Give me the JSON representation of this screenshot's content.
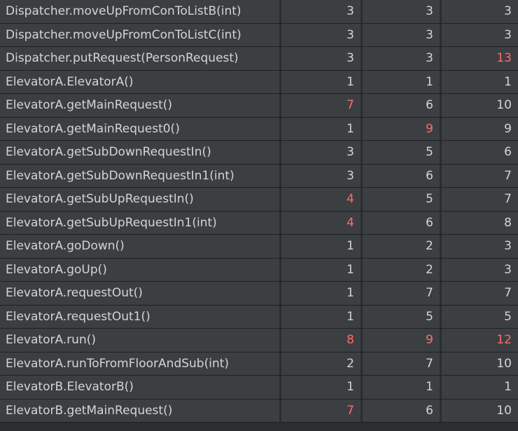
{
  "highlight_color": "#ff6b68",
  "rows": [
    {
      "method": "Dispatcher.moveUpFromConToListB(int)",
      "c1": "3",
      "c2": "3",
      "c3": "3",
      "h1": false,
      "h2": false,
      "h3": false
    },
    {
      "method": "Dispatcher.moveUpFromConToListC(int)",
      "c1": "3",
      "c2": "3",
      "c3": "3",
      "h1": false,
      "h2": false,
      "h3": false
    },
    {
      "method": "Dispatcher.putRequest(PersonRequest)",
      "c1": "3",
      "c2": "3",
      "c3": "13",
      "h1": false,
      "h2": false,
      "h3": true
    },
    {
      "method": "ElevatorA.ElevatorA()",
      "c1": "1",
      "c2": "1",
      "c3": "1",
      "h1": false,
      "h2": false,
      "h3": false
    },
    {
      "method": "ElevatorA.getMainRequest()",
      "c1": "7",
      "c2": "6",
      "c3": "10",
      "h1": true,
      "h2": false,
      "h3": false
    },
    {
      "method": "ElevatorA.getMainRequest0()",
      "c1": "1",
      "c2": "9",
      "c3": "9",
      "h1": false,
      "h2": true,
      "h3": false
    },
    {
      "method": "ElevatorA.getSubDownRequestIn()",
      "c1": "3",
      "c2": "5",
      "c3": "6",
      "h1": false,
      "h2": false,
      "h3": false
    },
    {
      "method": "ElevatorA.getSubDownRequestIn1(int)",
      "c1": "3",
      "c2": "6",
      "c3": "7",
      "h1": false,
      "h2": false,
      "h3": false
    },
    {
      "method": "ElevatorA.getSubUpRequestIn()",
      "c1": "4",
      "c2": "5",
      "c3": "7",
      "h1": true,
      "h2": false,
      "h3": false
    },
    {
      "method": "ElevatorA.getSubUpRequestIn1(int)",
      "c1": "4",
      "c2": "6",
      "c3": "8",
      "h1": true,
      "h2": false,
      "h3": false
    },
    {
      "method": "ElevatorA.goDown()",
      "c1": "1",
      "c2": "2",
      "c3": "3",
      "h1": false,
      "h2": false,
      "h3": false
    },
    {
      "method": "ElevatorA.goUp()",
      "c1": "1",
      "c2": "2",
      "c3": "3",
      "h1": false,
      "h2": false,
      "h3": false
    },
    {
      "method": "ElevatorA.requestOut()",
      "c1": "1",
      "c2": "7",
      "c3": "7",
      "h1": false,
      "h2": false,
      "h3": false
    },
    {
      "method": "ElevatorA.requestOut1()",
      "c1": "1",
      "c2": "5",
      "c3": "5",
      "h1": false,
      "h2": false,
      "h3": false
    },
    {
      "method": "ElevatorA.run()",
      "c1": "8",
      "c2": "9",
      "c3": "12",
      "h1": true,
      "h2": true,
      "h3": true
    },
    {
      "method": "ElevatorA.runToFromFloorAndSub(int)",
      "c1": "2",
      "c2": "7",
      "c3": "10",
      "h1": false,
      "h2": false,
      "h3": false
    },
    {
      "method": "ElevatorB.ElevatorB()",
      "c1": "1",
      "c2": "1",
      "c3": "1",
      "h1": false,
      "h2": false,
      "h3": false
    },
    {
      "method": "ElevatorB.getMainRequest()",
      "c1": "7",
      "c2": "6",
      "c3": "10",
      "h1": true,
      "h2": false,
      "h3": false
    }
  ]
}
